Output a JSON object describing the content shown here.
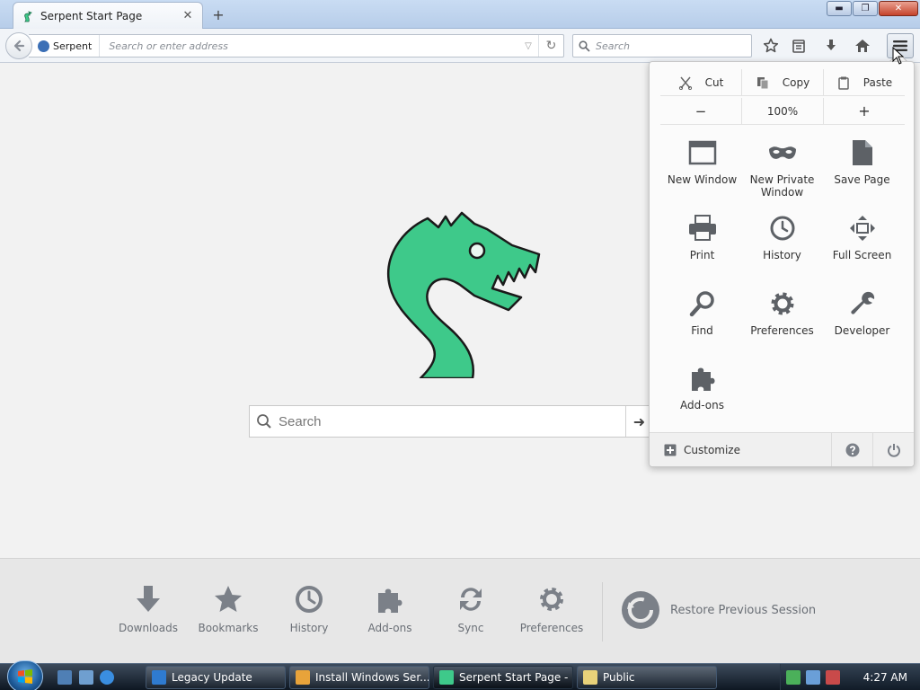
{
  "tab": {
    "title": "Serpent Start Page",
    "close_glyph": "✕",
    "new_tab_glyph": "+"
  },
  "window_buttons": {
    "minimize": "▬",
    "maximize": "❐",
    "close": "✕"
  },
  "navbar": {
    "identity_label": "Serpent",
    "address_placeholder": "Search or enter address",
    "search_placeholder": "Search",
    "reload_glyph": "↻",
    "dropdown_glyph": "▽",
    "toolbar_icons": [
      "bookmark-star-icon",
      "reading-list-icon",
      "downloads-icon",
      "home-icon",
      "menu-icon"
    ]
  },
  "content": {
    "search_placeholder": "Search",
    "search_go_glyph": "➜",
    "launcher": [
      {
        "label": "Downloads",
        "icon": "download-arrow-icon"
      },
      {
        "label": "Bookmarks",
        "icon": "star-icon"
      },
      {
        "label": "History",
        "icon": "clock-icon"
      },
      {
        "label": "Add-ons",
        "icon": "puzzle-icon"
      },
      {
        "label": "Sync",
        "icon": "sync-icon"
      },
      {
        "label": "Preferences",
        "icon": "gear-icon"
      }
    ],
    "restore_label": "Restore Previous Session"
  },
  "panel": {
    "edit": {
      "cut": "Cut",
      "copy": "Copy",
      "paste": "Paste"
    },
    "zoom": {
      "minus": "−",
      "level": "100%",
      "plus": "+"
    },
    "items": [
      {
        "label": "New Window",
        "icon": "new-window-icon"
      },
      {
        "label": "New Private Window",
        "icon": "private-mask-icon"
      },
      {
        "label": "Save Page",
        "icon": "save-page-icon"
      },
      {
        "label": "Print",
        "icon": "printer-icon"
      },
      {
        "label": "History",
        "icon": "clock-icon"
      },
      {
        "label": "Full Screen",
        "icon": "fullscreen-icon"
      },
      {
        "label": "Find",
        "icon": "magnifier-icon"
      },
      {
        "label": "Preferences",
        "icon": "gear-icon"
      },
      {
        "label": "Developer",
        "icon": "wrench-icon"
      },
      {
        "label": "Add-ons",
        "icon": "puzzle-icon"
      }
    ],
    "customize_label": "Customize"
  },
  "taskbar": {
    "buttons": [
      {
        "label": "Legacy Update",
        "icon": "shield-up-icon"
      },
      {
        "label": "Install Windows Ser...",
        "icon": "windows-installer-icon"
      },
      {
        "label": "Serpent Start Page - ...",
        "icon": "serpent-icon"
      },
      {
        "label": "Public",
        "icon": "folder-icon"
      }
    ],
    "clock": "4:27 AM"
  },
  "colors": {
    "serpent_green": "#3ec98a",
    "serpent_outline": "#1a1a1a",
    "icon_gray": "#6d7176",
    "panel_icon": "#5d6166"
  }
}
